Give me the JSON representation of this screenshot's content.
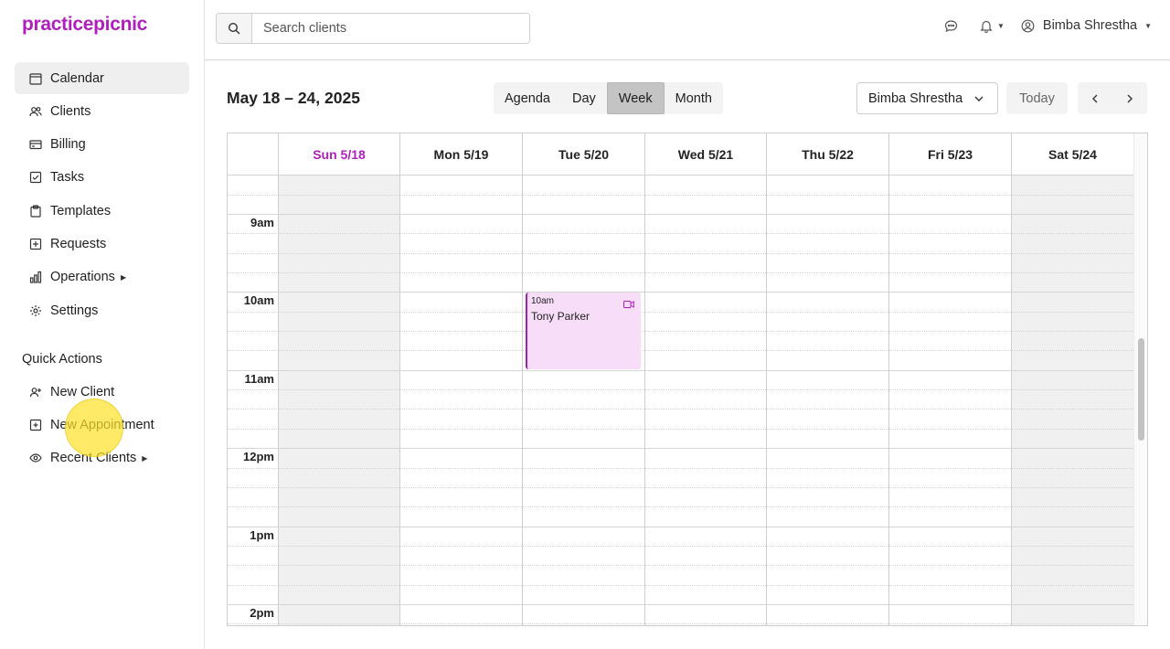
{
  "app": {
    "logo": "practicepicnic"
  },
  "sidebar": {
    "items": [
      {
        "label": "Calendar",
        "icon": "calendar-icon",
        "active": true
      },
      {
        "label": "Clients",
        "icon": "users-icon"
      },
      {
        "label": "Billing",
        "icon": "credit-card-icon"
      },
      {
        "label": "Tasks",
        "icon": "checkbox-icon"
      },
      {
        "label": "Templates",
        "icon": "clipboard-icon"
      },
      {
        "label": "Requests",
        "icon": "plus-square-icon"
      },
      {
        "label": "Operations",
        "icon": "bar-chart-icon",
        "has_submenu": true
      },
      {
        "label": "Settings",
        "icon": "gear-icon"
      }
    ],
    "quick_actions_title": "Quick Actions",
    "quick_actions": [
      {
        "label": "New Client",
        "icon": "user-plus-icon"
      },
      {
        "label": "New Appointment",
        "icon": "calendar-plus-icon"
      },
      {
        "label": "Recent Clients",
        "icon": "eye-icon",
        "has_submenu": true
      }
    ]
  },
  "topbar": {
    "search": {
      "placeholder": "Search clients",
      "value": ""
    },
    "user_name": "Bimba Shrestha"
  },
  "toolbar": {
    "date_range": "May 18 – 24, 2025",
    "views": [
      "Agenda",
      "Day",
      "Week",
      "Month"
    ],
    "active_view": "Week",
    "provider": "Bimba Shrestha",
    "today_label": "Today"
  },
  "calendar": {
    "days": [
      "Sun 5/18",
      "Mon 5/19",
      "Tue 5/20",
      "Wed 5/21",
      "Thu 5/22",
      "Fri 5/23",
      "Sat 5/24"
    ],
    "today_index": 0,
    "hours": [
      "9am",
      "10am",
      "11am",
      "12pm",
      "1pm",
      "2pm"
    ],
    "events": [
      {
        "time": "10am",
        "title": "Tony Parker",
        "day": "Tue 5/20",
        "type": "video"
      }
    ]
  },
  "colors": {
    "brand": "#b01fbd",
    "event_bg": "#f7ddf8",
    "event_border": "#a61fb0"
  }
}
